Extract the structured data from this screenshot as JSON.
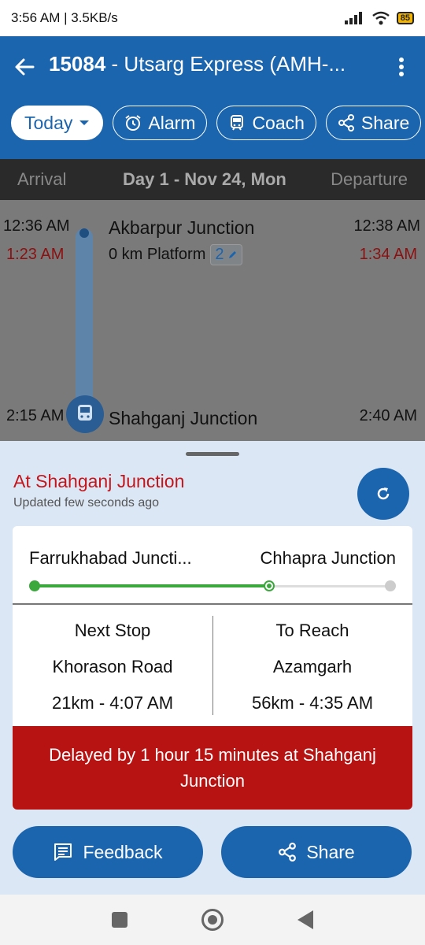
{
  "status_bar": {
    "time_speed": "3:56 AM | 3.5KB/s",
    "battery": "85"
  },
  "app_bar": {
    "train_number": "15084",
    "title_rest": " - Utsarg Express (AMH-...",
    "chips": {
      "today": "Today",
      "alarm": "Alarm",
      "coach": "Coach",
      "share": "Share"
    }
  },
  "day_header": {
    "arrival": "Arrival",
    "day": "Day 1 - Nov 24, Mon",
    "departure": "Departure"
  },
  "stops": [
    {
      "arr": "12:36 AM",
      "arr_actual": "1:23 AM",
      "name": "Akbarpur Junction",
      "detail": "0 km Platform",
      "platform": "2",
      "dep": "12:38 AM",
      "dep_actual": "1:34 AM"
    },
    {
      "arr": "2:15 AM",
      "name": "Shahganj Junction",
      "dep": "2:40 AM"
    }
  ],
  "sheet": {
    "current_status": "At Shahganj Junction",
    "updated": "Updated few seconds ago",
    "from": "Farrukhabad Juncti...",
    "to": "Chhapra Junction",
    "progress_fraction": 0.66,
    "next_stop_label": "Next Stop",
    "next_stop_name": "Khorason Road",
    "next_stop_eta": "21km - 4:07 AM",
    "to_reach_label": "To Reach",
    "to_reach_name": "Azamgarh",
    "to_reach_eta": "56km - 4:35 AM",
    "delay_message": "Delayed by 1 hour 15 minutes at Shahganj Junction",
    "feedback_label": "Feedback",
    "share_label": "Share"
  }
}
